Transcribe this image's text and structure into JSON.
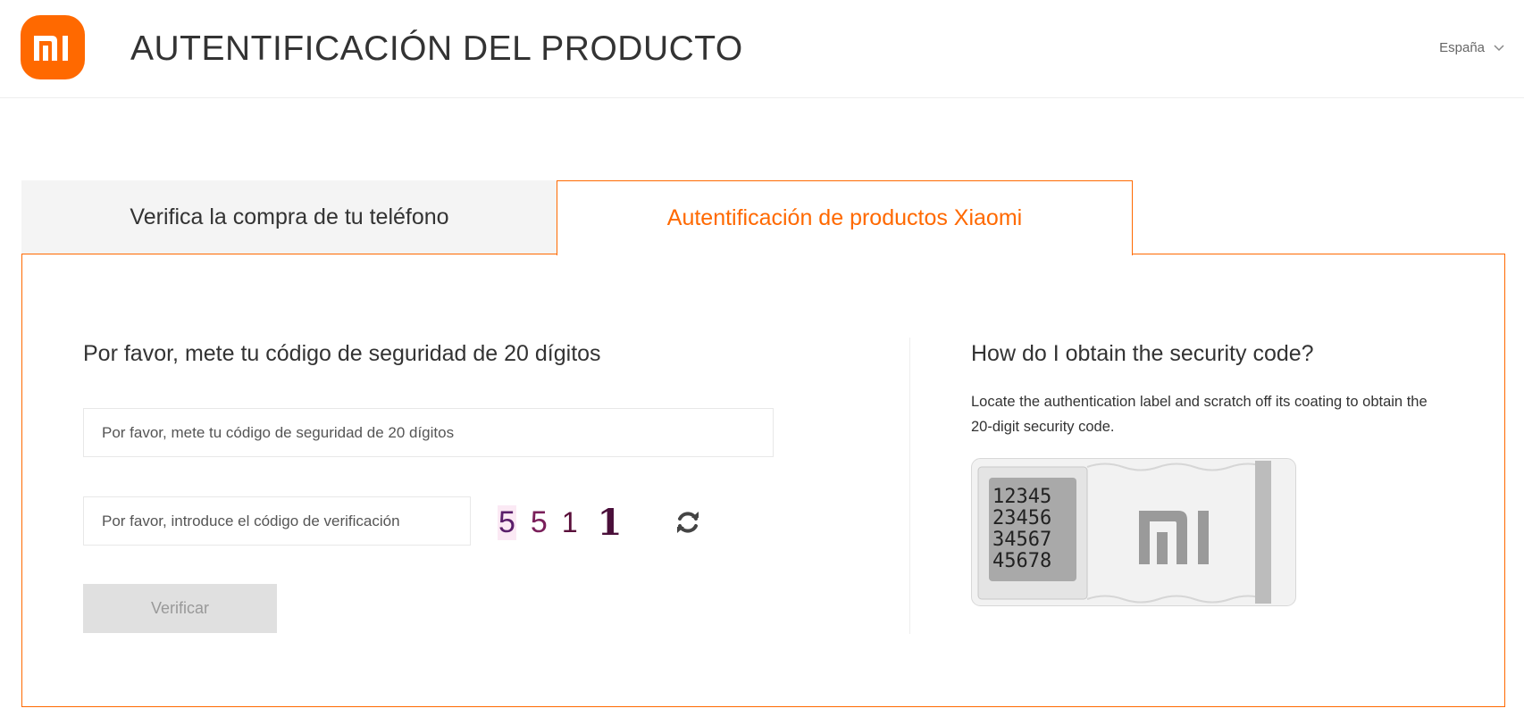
{
  "header": {
    "logo": "mi-logo",
    "title": "AUTENTIFICACIÓN DEL PRODUCTO",
    "region": "España",
    "region_icon": "chevron-down-icon"
  },
  "tabs": [
    {
      "label": "Verifica la compra de tu teléfono",
      "active": false
    },
    {
      "label": "Autentificación de productos Xiaomi",
      "active": true
    }
  ],
  "form": {
    "title": "Por favor, mete tu código de seguridad de 20 dígitos",
    "code_placeholder": "Por favor, mete tu código de seguridad de 20 dígitos",
    "code_value": "",
    "verification_placeholder": "Por favor, introduce el código de verificación",
    "verification_value": "",
    "captcha": [
      "5",
      "5",
      "1",
      "1"
    ],
    "refresh_icon": "refresh-icon",
    "submit_label": "Verificar"
  },
  "help": {
    "title": "How do I obtain the security code?",
    "text": "Locate the authentication label and scratch off its coating to obtain the 20-digit security code.",
    "label_image": {
      "code_lines": [
        "12345",
        "23456",
        "34567",
        "45678"
      ],
      "logo": "mi-logo"
    }
  },
  "colors": {
    "accent": "#ff6900",
    "button_disabled": "#e0e0e0"
  }
}
